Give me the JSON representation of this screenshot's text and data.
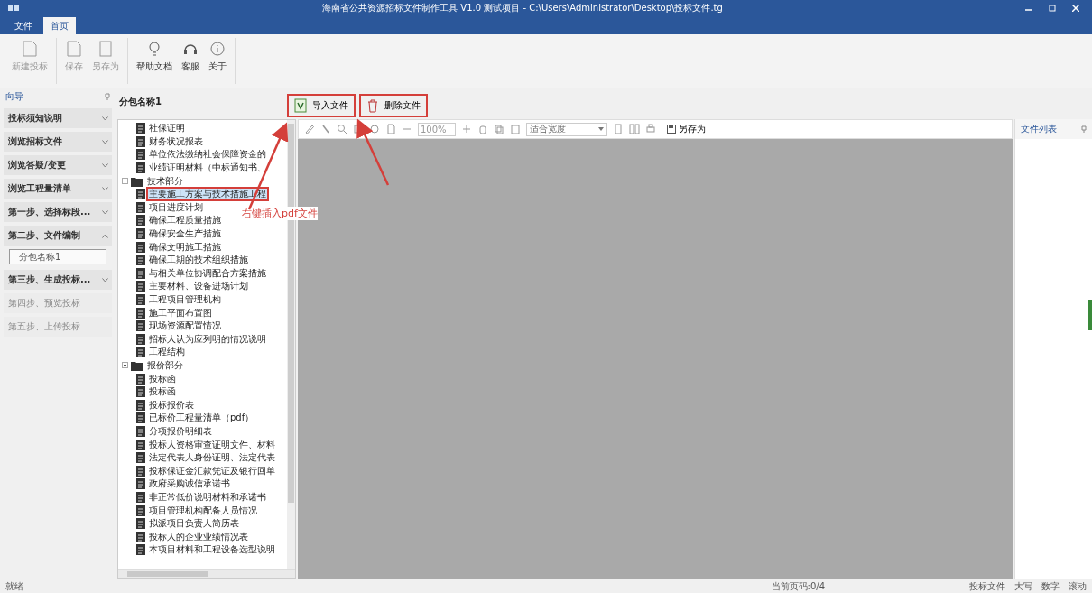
{
  "window": {
    "title": "海南省公共资源招标文件制作工具 V1.0 测试项目 - C:\\Users\\Administrator\\Desktop\\投标文件.tg"
  },
  "ribbon_tabs": [
    {
      "label": "文件",
      "selected": false
    },
    {
      "label": "首页",
      "selected": true
    }
  ],
  "ribbon_groups": [
    [
      {
        "label": "新建投标",
        "disabled": true
      }
    ],
    [
      {
        "label": "保存",
        "disabled": true
      },
      {
        "label": "另存为",
        "disabled": true
      }
    ],
    [
      {
        "label": "帮助文档",
        "disabled": false
      },
      {
        "label": "客服",
        "disabled": false
      },
      {
        "label": "关于",
        "disabled": false
      }
    ]
  ],
  "nav": {
    "title": "向导",
    "items": [
      {
        "label": "投标须知说明",
        "expanded": false,
        "disabled": false
      },
      {
        "label": "浏览招标文件",
        "expanded": false,
        "disabled": false
      },
      {
        "label": "浏览答疑/变更",
        "expanded": false,
        "disabled": false
      },
      {
        "label": "浏览工程量清单",
        "expanded": false,
        "disabled": false
      },
      {
        "label": "第一步、选择标段...",
        "expanded": false,
        "disabled": false
      },
      {
        "label": "第二步、文件编制",
        "expanded": true,
        "disabled": false,
        "children": [
          {
            "label": "分包名称1",
            "selected": true
          }
        ]
      },
      {
        "label": "第三步、生成投标...",
        "expanded": false,
        "disabled": false
      },
      {
        "label": "第四步、预览投标",
        "disabled": true
      },
      {
        "label": "第五步、上传投标",
        "disabled": true
      }
    ]
  },
  "tree": {
    "title": "分包名称1",
    "continued_items": [
      {
        "label": "社保证明",
        "selected": false
      },
      {
        "label": "财务状况报表",
        "selected": false
      },
      {
        "label": "单位依法缴纳社会保障资金的",
        "selected": false
      },
      {
        "label": "业绩证明材料（中标通知书、",
        "selected": false
      }
    ],
    "folders": [
      {
        "label": "技术部分",
        "expanded": true,
        "children": [
          {
            "label": "主要施工方案与技术措施工程",
            "selected": true,
            "annotated": true
          },
          {
            "label": "项目进度计划",
            "selected": false
          },
          {
            "label": "确保工程质量措施",
            "selected": false
          },
          {
            "label": "确保安全生产措施",
            "selected": false
          },
          {
            "label": "确保文明施工措施",
            "selected": false
          },
          {
            "label": "确保工期的技术组织措施",
            "selected": false
          },
          {
            "label": "与相关单位协调配合方案措施",
            "selected": false
          },
          {
            "label": "主要材料、设备进场计划",
            "selected": false
          },
          {
            "label": "工程项目管理机构",
            "selected": false
          },
          {
            "label": "施工平面布置图",
            "selected": false
          },
          {
            "label": "现场资源配置情况",
            "selected": false
          },
          {
            "label": "招标人认为应列明的情况说明",
            "selected": false
          },
          {
            "label": "工程结构",
            "selected": false
          }
        ]
      },
      {
        "label": "报价部分",
        "expanded": true,
        "children": [
          {
            "label": "投标函",
            "selected": false
          },
          {
            "label": "投标函",
            "selected": false
          },
          {
            "label": "投标报价表",
            "selected": false
          },
          {
            "label": "已标价工程量清单（pdf）",
            "selected": false
          },
          {
            "label": "分项报价明细表",
            "selected": false
          },
          {
            "label": "投标人资格审查证明文件、材料",
            "selected": false
          },
          {
            "label": "法定代表人身份证明、法定代表",
            "selected": false
          },
          {
            "label": "投标保证金汇款凭证及银行回单",
            "selected": false
          },
          {
            "label": "政府采购诚信承诺书",
            "selected": false
          },
          {
            "label": "非正常低价说明材料和承诺书",
            "selected": false
          },
          {
            "label": "项目管理机构配备人员情况",
            "selected": false
          },
          {
            "label": "拟派项目负责人简历表",
            "selected": false
          },
          {
            "label": "投标人的企业业绩情况表",
            "selected": false
          },
          {
            "label": "本项目材料和工程设备选型说明",
            "selected": false
          }
        ]
      }
    ]
  },
  "file_actions": [
    {
      "label": "导入文件",
      "annotated": true
    },
    {
      "label": "删除文件",
      "annotated": true
    }
  ],
  "viewer_toolbar": {
    "zoom": "100%",
    "fit": "适合宽度",
    "save_label": "另存为"
  },
  "file_list": {
    "title": "文件列表"
  },
  "annotation": {
    "text": "右键插入pdf文件"
  },
  "status_bar": {
    "left": "就绪",
    "center": "当前页码:0/4",
    "right": [
      "投标文件",
      "大写",
      "数字",
      "滚动"
    ]
  }
}
